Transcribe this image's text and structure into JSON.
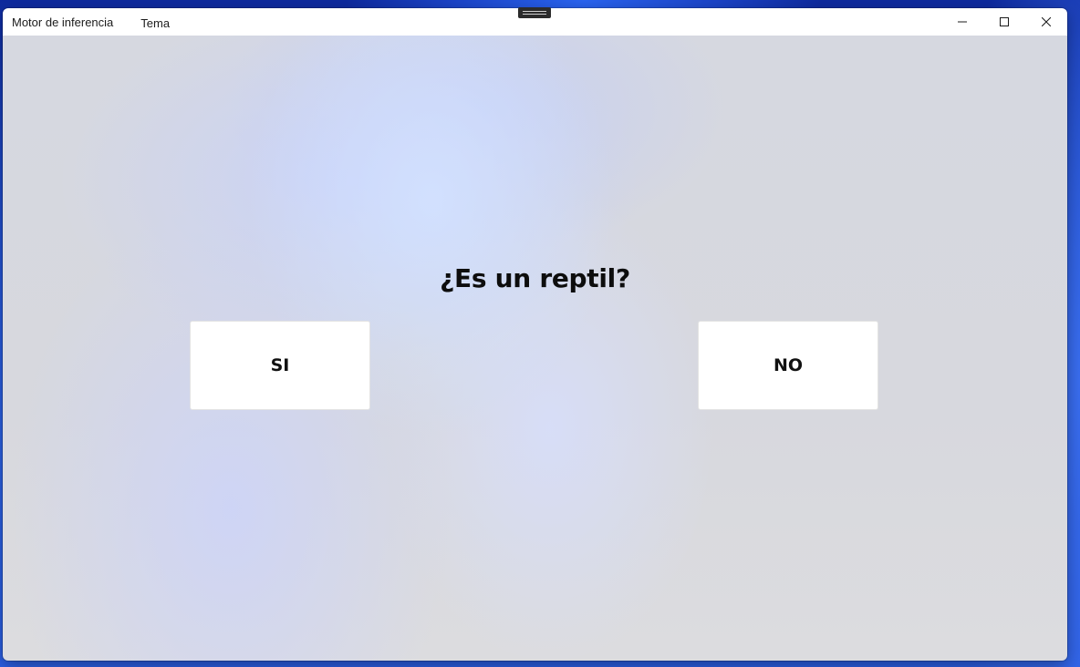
{
  "window": {
    "title": "Motor de inferencia",
    "menu": [
      "Tema"
    ]
  },
  "caption_buttons": {
    "minimize": "minimize-icon",
    "maximize": "maximize-icon",
    "close": "close-icon"
  },
  "main": {
    "question": "¿Es un reptil?",
    "yes_label": "SI",
    "no_label": "NO"
  },
  "colors": {
    "titlebar": "#ffffff",
    "client_background": "#d7d8de",
    "button_background": "#ffffff",
    "text": "#0d0d0d"
  }
}
